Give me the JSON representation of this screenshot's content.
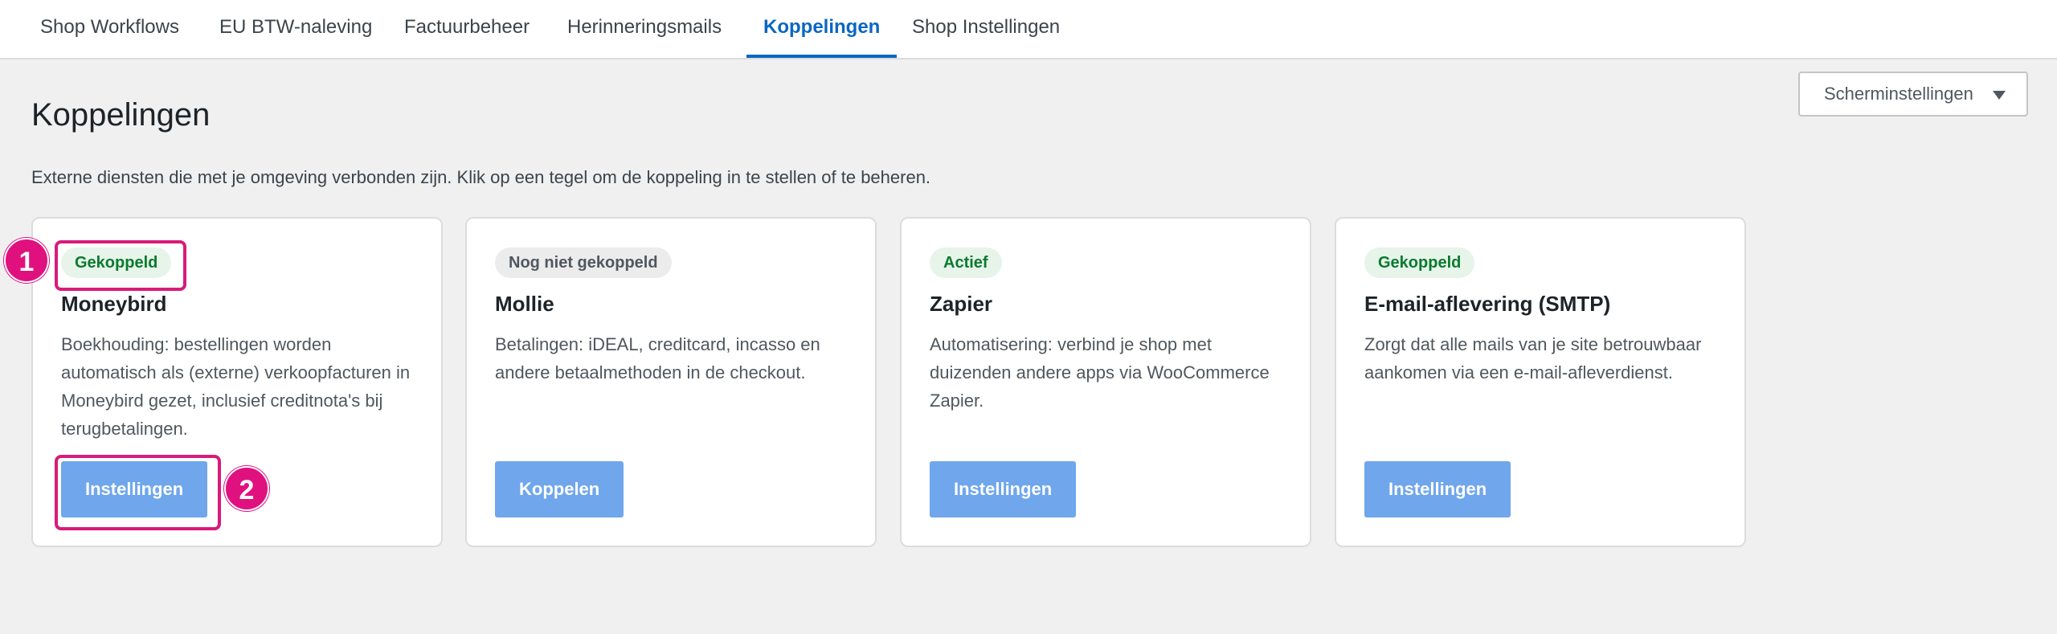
{
  "tabs": [
    {
      "label": "Shop Workflows"
    },
    {
      "label": "EU BTW-naleving"
    },
    {
      "label": "Factuurbeheer"
    },
    {
      "label": "Herinneringsmails"
    },
    {
      "label": "Koppelingen",
      "active": true
    },
    {
      "label": "Shop Instellingen"
    }
  ],
  "screen_options": {
    "label": "Scherminstellingen"
  },
  "page": {
    "title": "Koppelingen",
    "description": "Externe diensten die met je omgeving verbonden zijn. Klik op een tegel om de koppeling in te stellen of te beheren."
  },
  "cards": [
    {
      "badge": "Gekoppeld",
      "badge_status": "connected",
      "title": "Moneybird",
      "description": "Boekhouding: bestellingen worden automatisch als (externe) verkoopfacturen in Moneybird gezet, inclusief creditnota's bij terugbetalingen.",
      "button": "Instellingen"
    },
    {
      "badge": "Nog niet gekoppeld",
      "badge_status": "not-connected",
      "title": "Mollie",
      "description": "Betalingen: iDEAL, creditcard, incasso en andere betaalmethoden in de checkout.",
      "button": "Koppelen"
    },
    {
      "badge": "Actief",
      "badge_status": "active",
      "title": "Zapier",
      "description": "Automatisering: verbind je shop met duizenden andere apps via WooCommerce Zapier.",
      "button": "Instellingen"
    },
    {
      "badge": "Gekoppeld",
      "badge_status": "connected",
      "title": "E-mail-aflevering (SMTP)",
      "description": "Zorgt dat alle mails van je site betrouwbaar aankomen via een e-mail-afleverdienst.",
      "button": "Instellingen"
    }
  ],
  "annotations": [
    {
      "number": "1"
    },
    {
      "number": "2"
    }
  ],
  "colors": {
    "accent": "#0a66c2",
    "button": "#6fa6ec",
    "badge_green_bg": "#e6f4ea",
    "badge_green_text": "#0b7a2e",
    "badge_grey_bg": "#ececec",
    "highlight": "#e0117f"
  }
}
